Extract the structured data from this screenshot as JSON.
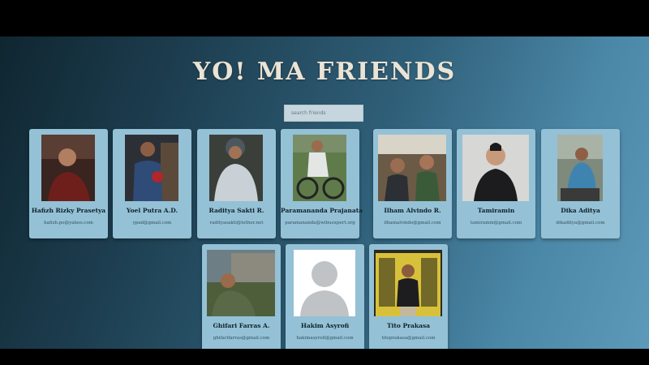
{
  "page": {
    "title": "YO! MA FRIENDS",
    "search_placeholder": "search friends"
  },
  "friends": [
    {
      "name": "Hafizh Rizky Prasetya",
      "email": "hafizh.po@yahoo.com"
    },
    {
      "name": "Yoel Putra A.D.",
      "email": "ypad@gmail.com"
    },
    {
      "name": "Raditya Sakti R.",
      "email": "radityasakti@tether.net"
    },
    {
      "name": "Paramananda Prajanata",
      "email": "paramananda@wibuexpert.org"
    },
    {
      "name": "Ilham Alvindo R.",
      "email": "ilhamalvindo@gmail.com"
    },
    {
      "name": "Tamiramin",
      "email": "tamiramin@gmail.com"
    },
    {
      "name": "Dika Aditya",
      "email": "dikaditya@gmail.com"
    },
    {
      "name": "Ghifari Farras A.",
      "email": "ghifarifarras@gmail.com"
    },
    {
      "name": "Hakim Asyrofi",
      "email": "hakimasyrofi@gmail.com"
    },
    {
      "name": "Tito Prakasa",
      "email": "titoprakasa@gmail.com"
    }
  ],
  "colors": {
    "card_bg": "#94c1d6",
    "title": "#ebe3d4"
  }
}
